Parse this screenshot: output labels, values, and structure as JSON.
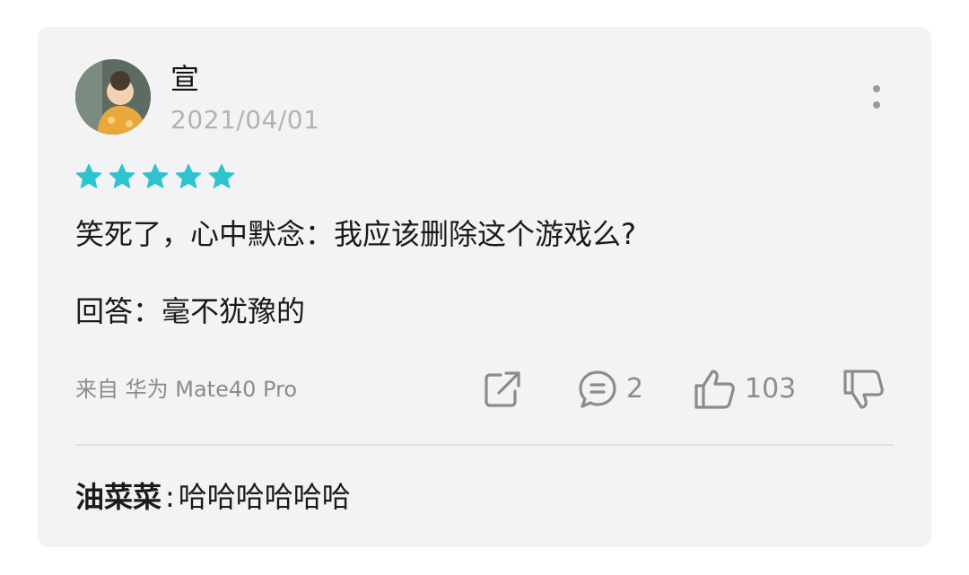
{
  "review": {
    "username": "宣",
    "date": "2021/04/01",
    "rating": 5,
    "star_color": "#2ec4cf",
    "lines": [
      "笑死了，心中默念：我应该删除这个游戏么?",
      "回答：毫不犹豫的"
    ],
    "device": "来自 华为 Mate40 Pro",
    "actions": {
      "share_icon": "share-icon",
      "comment_count": "2",
      "like_count": "103"
    }
  },
  "reply": {
    "author": "油菜菜",
    "separator": ":",
    "text": "哈哈哈哈哈哈"
  }
}
